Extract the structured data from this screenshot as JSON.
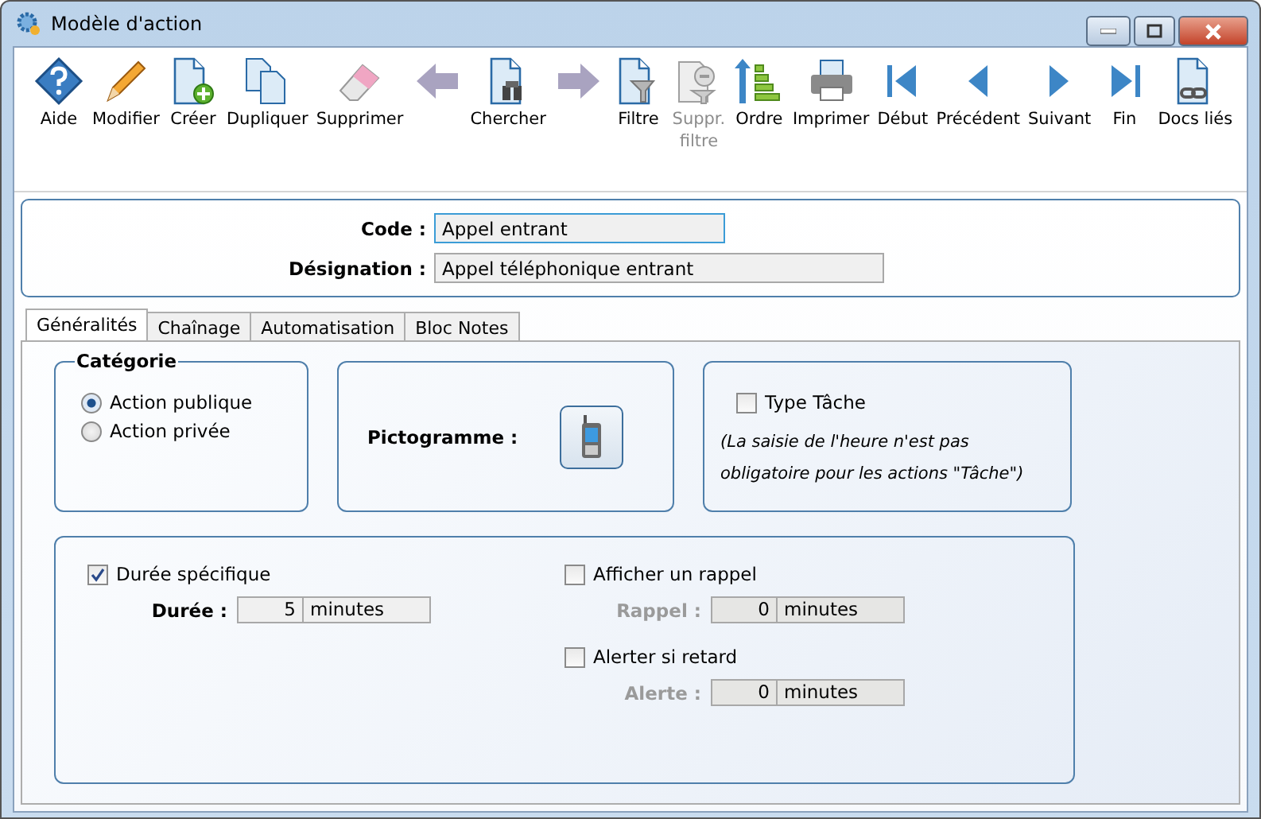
{
  "window": {
    "title": "Modèle d'action"
  },
  "toolbar": [
    {
      "kind": "help",
      "label": "Aide",
      "disabled": false
    },
    {
      "kind": "pencil",
      "label": "Modifier",
      "disabled": false
    },
    {
      "kind": "new",
      "label": "Créer",
      "disabled": false
    },
    {
      "kind": "copy",
      "label": "Dupliquer",
      "disabled": false
    },
    {
      "kind": "eraser",
      "label": "Supprimer",
      "disabled": false
    },
    {
      "kind": "back",
      "disabled": true
    },
    {
      "kind": "search",
      "label": "Chercher",
      "disabled": false
    },
    {
      "kind": "forward",
      "disabled": true
    },
    {
      "kind": "filter",
      "label": "Filtre",
      "disabled": false
    },
    {
      "kind": "unfilter",
      "label": "Suppr. filtre",
      "disabled": true
    },
    {
      "kind": "sort",
      "label": "Ordre",
      "disabled": false
    },
    {
      "kind": "print",
      "label": "Imprimer",
      "disabled": false
    },
    {
      "kind": "first",
      "label": "Début",
      "disabled": false
    },
    {
      "kind": "prev",
      "label": "Précédent",
      "disabled": false
    },
    {
      "kind": "next",
      "label": "Suivant",
      "disabled": false
    },
    {
      "kind": "last",
      "label": "Fin",
      "disabled": false
    },
    {
      "kind": "docs",
      "label": "Docs liés",
      "disabled": false
    }
  ],
  "form": {
    "code": {
      "label": "Code :",
      "value": "Appel entrant"
    },
    "designation": {
      "label": "Désignation :",
      "value": "Appel téléphonique entrant"
    }
  },
  "tabs": [
    {
      "label": "Généralités",
      "selected": true
    },
    {
      "label": "Chaînage",
      "selected": false
    },
    {
      "label": "Automatisation",
      "selected": false
    },
    {
      "label": "Bloc Notes",
      "selected": false
    }
  ],
  "categorie": {
    "title": "Catégorie",
    "options": [
      {
        "label": "Action publique",
        "selected": true
      },
      {
        "label": "Action privée",
        "selected": false
      }
    ]
  },
  "pictogramme": {
    "label": "Pictogramme :"
  },
  "type_tache": {
    "label": "Type Tâche",
    "checked": false,
    "note": "(La saisie de l'heure n'est pas obligatoire pour les actions \"Tâche\")"
  },
  "durations": [
    {
      "check_label": "Durée spécifique",
      "checked": true,
      "label": "Durée :",
      "value": "5",
      "unit": "minutes",
      "disabled": false
    },
    {
      "check_label": "Afficher un rappel",
      "checked": false,
      "label": "Rappel :",
      "value": "0",
      "unit": "minutes",
      "disabled": true
    },
    {
      "check_label": "Alerter si retard",
      "checked": false,
      "label": "Alerte :",
      "value": "0",
      "unit": "minutes",
      "disabled": true
    }
  ]
}
